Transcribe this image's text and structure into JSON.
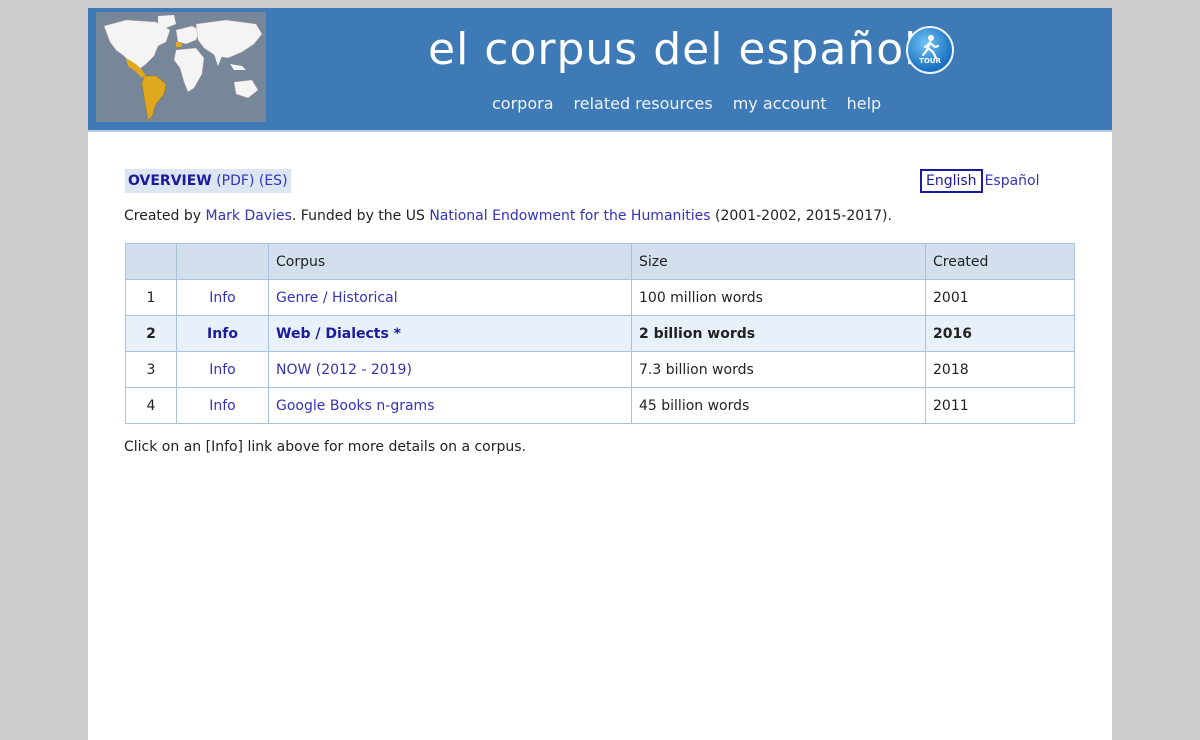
{
  "header": {
    "title": "el corpus del español",
    "tour_label": "TOUR",
    "nav": [
      "corpora",
      "related resources",
      "my account",
      "help"
    ]
  },
  "overview": {
    "label": "OVERVIEW",
    "pdf": "(PDF)",
    "es": "(ES)"
  },
  "language": {
    "english": "English",
    "espanol": "Español"
  },
  "credit": {
    "prefix": "Created by ",
    "author": "Mark Davies",
    "middle": ". Funded by the US ",
    "funder": "National Endowment for the Humanities",
    "suffix": " (2001-2002, 2015-2017)."
  },
  "table": {
    "headers": [
      "",
      "",
      "Corpus",
      "Size",
      "Created"
    ],
    "rows": [
      {
        "num": "1",
        "info": "Info",
        "corpus": "Genre / Historical",
        "size": "100 million words",
        "created": "2001"
      },
      {
        "num": "2",
        "info": "Info",
        "corpus": "Web / Dialects *",
        "size": "2 billion words",
        "created": "2016"
      },
      {
        "num": "3",
        "info": "Info",
        "corpus": "NOW (2012 - 2019)",
        "size": "7.3 billion words",
        "created": "2018"
      },
      {
        "num": "4",
        "info": "Info",
        "corpus": "Google Books n-grams",
        "size": "45 billion words",
        "created": "2011"
      }
    ]
  },
  "note": "Click on an [Info] link above for more details on a corpus.",
  "colors": {
    "header_bg": "#3e7bb6",
    "map_highlight": "#e0a81c",
    "link": "#3333bb"
  }
}
